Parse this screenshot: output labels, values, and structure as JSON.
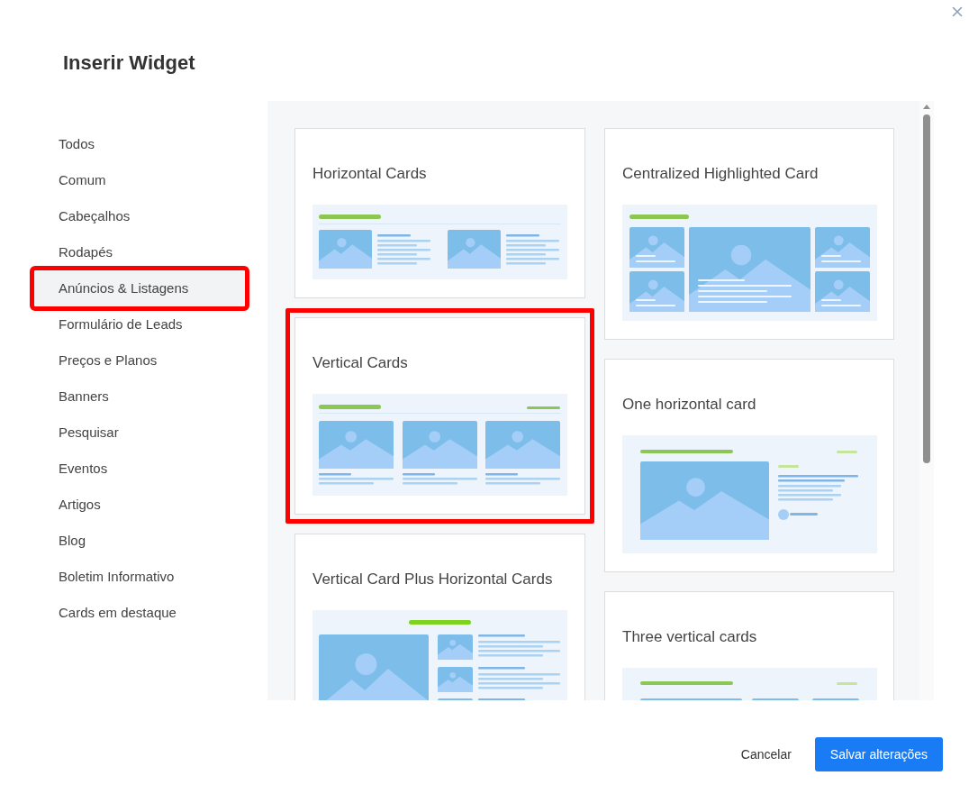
{
  "dialog": {
    "title": "Inserir Widget"
  },
  "categories": [
    {
      "label": "Todos",
      "selected": false,
      "highlighted": false
    },
    {
      "label": "Comum",
      "selected": false,
      "highlighted": false
    },
    {
      "label": "Cabeçalhos",
      "selected": false,
      "highlighted": false
    },
    {
      "label": "Rodapés",
      "selected": false,
      "highlighted": false
    },
    {
      "label": "Anúncios & Listagens",
      "selected": true,
      "highlighted": true
    },
    {
      "label": "Formulário de Leads",
      "selected": false,
      "highlighted": false
    },
    {
      "label": "Preços e Planos",
      "selected": false,
      "highlighted": false
    },
    {
      "label": "Banners",
      "selected": false,
      "highlighted": false
    },
    {
      "label": "Pesquisar",
      "selected": false,
      "highlighted": false
    },
    {
      "label": "Eventos",
      "selected": false,
      "highlighted": false
    },
    {
      "label": "Artigos",
      "selected": false,
      "highlighted": false
    },
    {
      "label": "Blog",
      "selected": false,
      "highlighted": false
    },
    {
      "label": "Boletim Informativo",
      "selected": false,
      "highlighted": false
    },
    {
      "label": "Cards em destaque",
      "selected": false,
      "highlighted": false
    }
  ],
  "widget_columns": [
    {
      "widgets": [
        {
          "title": "Horizontal Cards",
          "kind": "horizontal",
          "highlighted": false
        },
        {
          "title": "Vertical Cards",
          "kind": "vertical",
          "highlighted": true
        },
        {
          "title": "Vertical Card Plus Horizontal Cards",
          "kind": "vertical-plus",
          "highlighted": false
        }
      ]
    },
    {
      "widgets": [
        {
          "title": "Centralized Highlighted Card",
          "kind": "centralized",
          "highlighted": false
        },
        {
          "title": "One horizontal card",
          "kind": "one-horizontal",
          "highlighted": false
        },
        {
          "title": "Three vertical cards",
          "kind": "three-vertical",
          "highlighted": false
        }
      ]
    }
  ],
  "buttons": [
    {
      "label": "Cancelar",
      "kind": "secondary"
    },
    {
      "label": "Salvar alterações",
      "kind": "primary"
    }
  ]
}
